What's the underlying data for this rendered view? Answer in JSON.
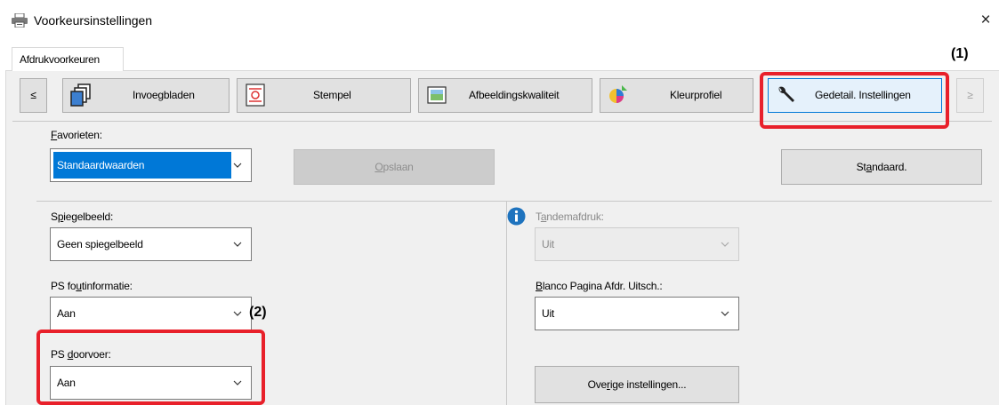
{
  "window": {
    "title": "Voorkeursinstellingen",
    "close_glyph": "×"
  },
  "tab": {
    "label": "Afdrukvoorkeuren"
  },
  "nav": {
    "scroll_left": "≤",
    "scroll_right": "≥",
    "buttons": [
      {
        "label": "Invoegbladen",
        "icon": "pages-icon"
      },
      {
        "label": "Stempel",
        "icon": "stamp-icon"
      },
      {
        "label": "Afbeeldingskwaliteit",
        "icon": "image-quality-icon"
      },
      {
        "label": "Kleurprofiel",
        "icon": "color-profile-icon"
      },
      {
        "label": "Gedetail. Instellingen",
        "icon": "wrench-icon"
      }
    ]
  },
  "favorites": {
    "label_pre": "",
    "label_u": "F",
    "label_post": "avorieten:",
    "value": "Standaardwaarden",
    "save_pre": "",
    "save_u": "O",
    "save_post": "pslaan",
    "default_pre": "St",
    "default_u": "a",
    "default_post": "ndaard."
  },
  "left": {
    "mirror_label_pre": "S",
    "mirror_label_u": "p",
    "mirror_label_post": "iegelbeeld:",
    "mirror_value": "Geen spiegelbeeld",
    "pserr_label_pre": "PS fo",
    "pserr_label_u": "u",
    "pserr_label_post": "tinformatie:",
    "pserr_value": "Aan",
    "pspass_label_pre": "PS ",
    "pspass_label_u": "d",
    "pspass_label_post": "oorvoer:",
    "pspass_value": "Aan"
  },
  "right": {
    "tandem_label_pre": "T",
    "tandem_label_u": "a",
    "tandem_label_post": "ndemafdruk:",
    "tandem_value": "Uit",
    "blank_label_pre": "",
    "blank_label_u": "B",
    "blank_label_post": "lanco Pagina Afdr. Uitsch.:",
    "blank_value": "Uit",
    "other_pre": "Ove",
    "other_u": "r",
    "other_post": "ige instellingen..."
  },
  "callouts": {
    "one": "(1)",
    "two": "(2)"
  },
  "colors": {
    "highlight": "#e8202a",
    "selection": "#0078d7",
    "info": "#1e73be"
  }
}
